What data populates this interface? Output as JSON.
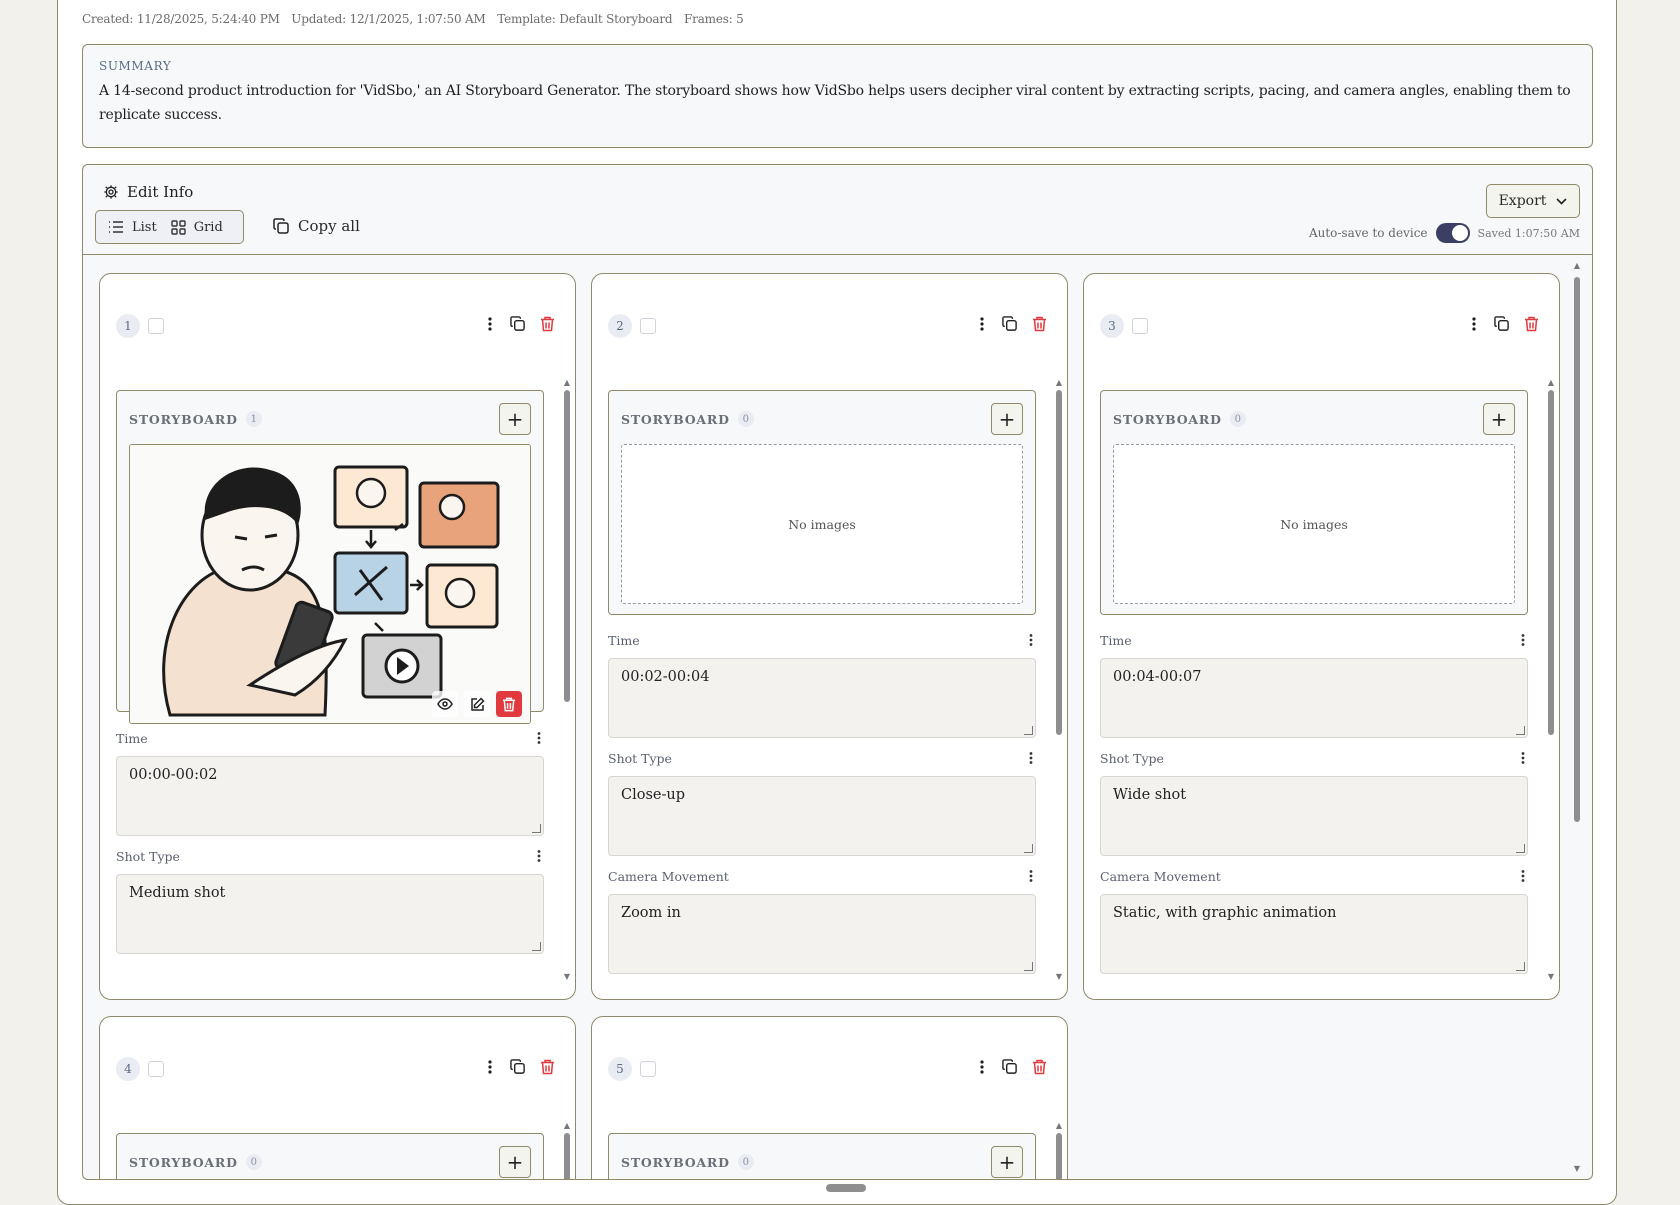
{
  "meta": {
    "created": "Created: 11/28/2025, 5:24:40 PM",
    "updated": "Updated: 12/1/2025, 1:07:50 AM",
    "template": "Template: Default Storyboard",
    "frames": "Frames: 5"
  },
  "summary": {
    "title": "SUMMARY",
    "text": "A 14-second product introduction for 'VidSbo,' an AI Storyboard Generator. The storyboard shows how VidSbo helps users decipher viral content by extracting scripts, pacing, and camera angles, enabling them to replicate success."
  },
  "toolbar": {
    "edit_info": "Edit Info",
    "list_label": "List",
    "grid_label": "Grid",
    "copy_all": "Copy all",
    "export": "Export",
    "autosave_label": "Auto-save to device",
    "saved": "Saved 1:07:50 AM"
  },
  "colors": {
    "accent_border": "#8e8a6a",
    "toggle_on": "#3b3f63",
    "danger": "#e0393e"
  },
  "labels": {
    "storyboard": "STORYBOARD",
    "no_images": "No images",
    "time": "Time",
    "shot_type": "Shot Type",
    "camera_movement": "Camera Movement",
    "add": "+"
  },
  "frames": [
    {
      "number": "1",
      "image_count": "1",
      "time": "00:00-00:02",
      "shot_type": "Medium shot",
      "camera_movement": ""
    },
    {
      "number": "2",
      "image_count": "0",
      "time": "00:02-00:04",
      "shot_type": "Close-up",
      "camera_movement": "Zoom in"
    },
    {
      "number": "3",
      "image_count": "0",
      "time": "00:04-00:07",
      "shot_type": "Wide shot",
      "camera_movement": "Static, with graphic animation"
    },
    {
      "number": "4",
      "image_count": "0",
      "time": "",
      "shot_type": "",
      "camera_movement": ""
    },
    {
      "number": "5",
      "image_count": "0",
      "time": "",
      "shot_type": "",
      "camera_movement": ""
    }
  ]
}
